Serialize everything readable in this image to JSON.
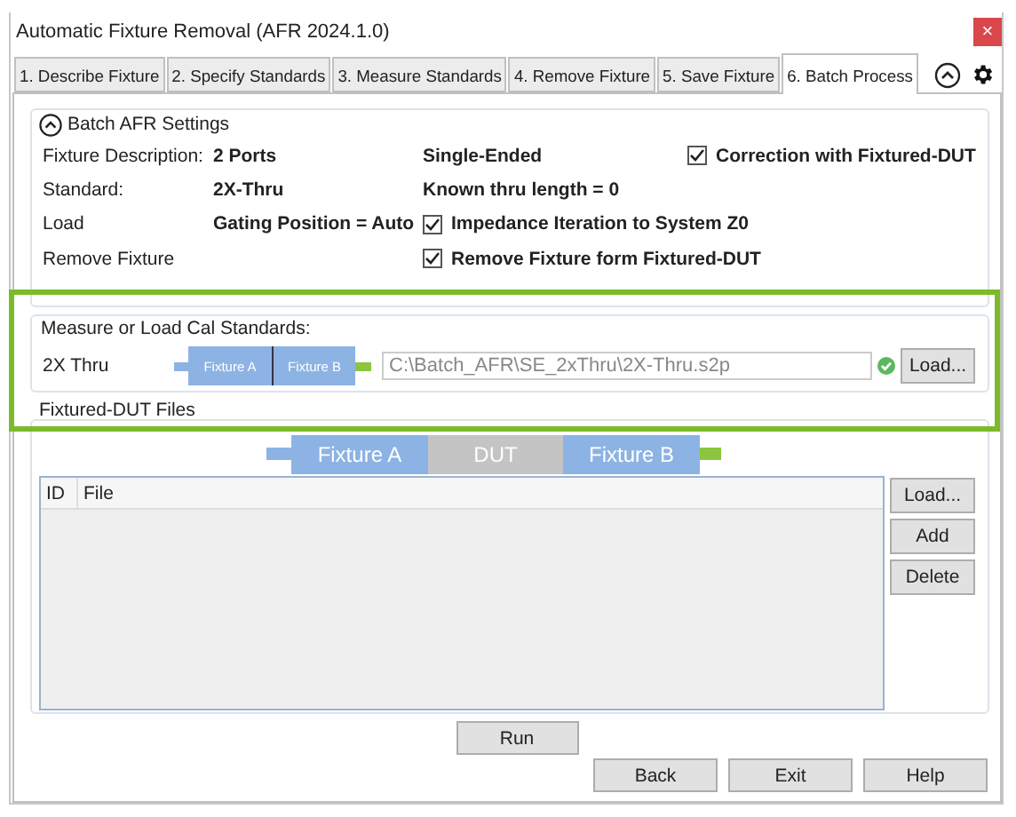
{
  "window": {
    "title": "Automatic Fixture Removal (AFR 2024.1.0)",
    "close": "×"
  },
  "tabs": [
    {
      "label": "1. Describe Fixture",
      "selected": false
    },
    {
      "label": "2. Specify Standards",
      "selected": false
    },
    {
      "label": "3. Measure Standards",
      "selected": false
    },
    {
      "label": "4. Remove Fixture",
      "selected": false
    },
    {
      "label": "5. Save Fixture",
      "selected": false
    },
    {
      "label": "6. Batch Process",
      "selected": true
    }
  ],
  "settings": {
    "title": "Batch AFR Settings",
    "expanded": true,
    "rows": [
      {
        "label": "Fixture Description:",
        "value": "2 Ports",
        "cells": [
          {
            "kind": "text",
            "text": "Single-Ended"
          },
          {
            "kind": "check",
            "text": "Correction with Fixtured-DUT",
            "checked": true
          }
        ]
      },
      {
        "label": "Standard:",
        "value": "2X-Thru",
        "cells": [
          {
            "kind": "text",
            "text": "Known thru length = 0"
          }
        ]
      },
      {
        "label": "Load",
        "value": "Gating Position = Auto",
        "cells": [
          {
            "kind": "check",
            "text": "Impedance Iteration to System Z0",
            "checked": true
          }
        ]
      },
      {
        "label": "Remove Fixture",
        "cells": [
          {
            "kind": "check",
            "text": "Remove Fixture form Fixtured-DUT",
            "checked": true
          }
        ]
      }
    ]
  },
  "standards": {
    "title": "Measure or Load Cal Standards:",
    "name": "2X Thru",
    "diagram": [
      "Fixture A",
      "Fixture B"
    ],
    "file": "C:\\Batch_AFR\\SE_2xThru\\2X-Thru.s2p",
    "valid": true,
    "button": "Load..."
  },
  "dut_files": {
    "title": "Fixtured-DUT Files",
    "diagram": [
      {
        "label": "Fixture A",
        "kind": "fixture"
      },
      {
        "label": "DUT",
        "kind": "dut"
      },
      {
        "label": "Fixture B",
        "kind": "fixture"
      }
    ],
    "columns": [
      "ID",
      "File"
    ],
    "buttons": [
      "Load...",
      "Add",
      "Delete"
    ]
  },
  "run": "Run",
  "footer_buttons": [
    "Back",
    "Exit",
    "Help"
  ],
  "highlight": true
}
